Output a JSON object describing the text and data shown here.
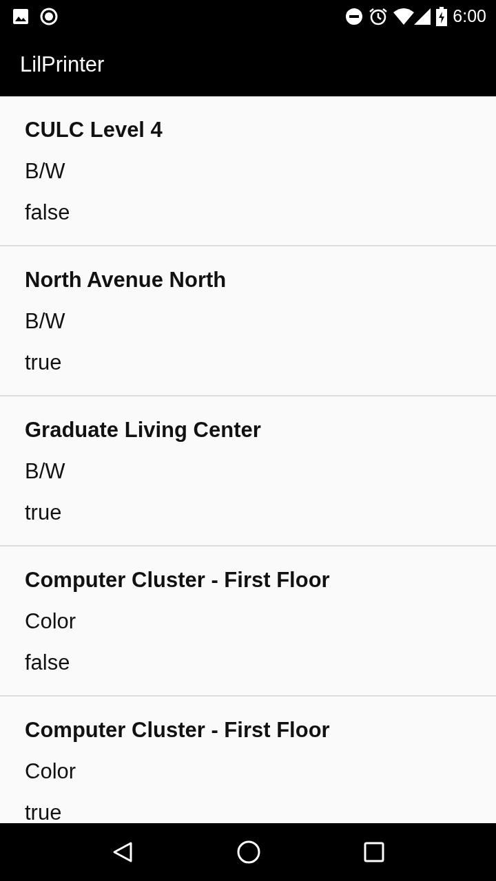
{
  "status_bar": {
    "time": "6:00"
  },
  "app_bar": {
    "title": "LilPrinter"
  },
  "printers": [
    {
      "name": "CULC Level 4",
      "mode": "B/W",
      "status": "false"
    },
    {
      "name": "North Avenue North",
      "mode": "B/W",
      "status": "true"
    },
    {
      "name": "Graduate Living Center",
      "mode": "B/W",
      "status": "true"
    },
    {
      "name": "Computer Cluster - First Floor",
      "mode": "Color",
      "status": "false"
    },
    {
      "name": "Computer Cluster - First Floor",
      "mode": "Color",
      "status": "true"
    }
  ]
}
